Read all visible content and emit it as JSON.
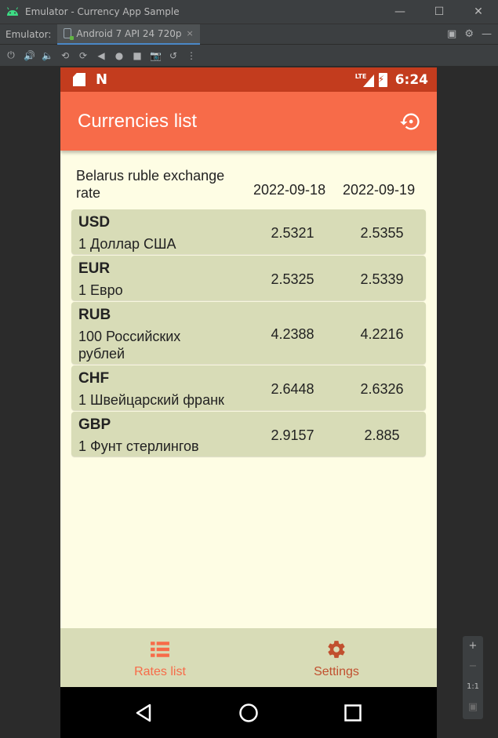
{
  "window": {
    "title": "Emulator - Currency App Sample",
    "minimize_icon": "minimize-icon",
    "maximize_icon": "maximize-icon",
    "close_icon": "close-icon"
  },
  "emulator_bar": {
    "label": "Emulator:",
    "tab_label": "Android 7 API 24 720p",
    "tab_close": "×"
  },
  "toolbar": {
    "icons": [
      "power-icon",
      "volume-up-icon",
      "volume-down-icon",
      "rotate-left-icon",
      "rotate-right-icon",
      "back-icon",
      "home-icon",
      "overview-icon",
      "screenshot-icon",
      "snapshot-icon",
      "more-icon"
    ]
  },
  "device": {
    "status": {
      "network": "LTE",
      "time": "6:24"
    },
    "app_bar": {
      "title": "Currencies list",
      "action_icon": "history-icon"
    },
    "table": {
      "header_label": "Belarus ruble exchange rate",
      "dates": [
        "2022-09-18",
        "2022-09-19"
      ],
      "rows": [
        {
          "code": "USD",
          "name": "1 Доллар США",
          "rate1": "2.5321",
          "rate2": "2.5355"
        },
        {
          "code": "EUR",
          "name": "1 Евро",
          "rate1": "2.5325",
          "rate2": "2.5339"
        },
        {
          "code": "RUB",
          "name": "100 Российских рублей",
          "rate1": "4.2388",
          "rate2": "4.2216"
        },
        {
          "code": "CHF",
          "name": "1 Швейцарский франк",
          "rate1": "2.6448",
          "rate2": "2.6326"
        },
        {
          "code": "GBP",
          "name": "1 Фунт стерлингов",
          "rate1": "2.9157",
          "rate2": "2.885"
        }
      ]
    },
    "bottom_nav": [
      {
        "label": "Rates list",
        "icon": "list-icon"
      },
      {
        "label": "Settings",
        "icon": "gear-icon"
      }
    ],
    "colors": {
      "status_bar": "#c33c1e",
      "app_bar": "#f76b49",
      "background": "#fefde4",
      "row": "#d8dcb7",
      "accent": "#c1502f"
    }
  },
  "zoom_panel": {
    "zoom_in": "+",
    "zoom_out": "−",
    "actual_size": "1:1"
  }
}
